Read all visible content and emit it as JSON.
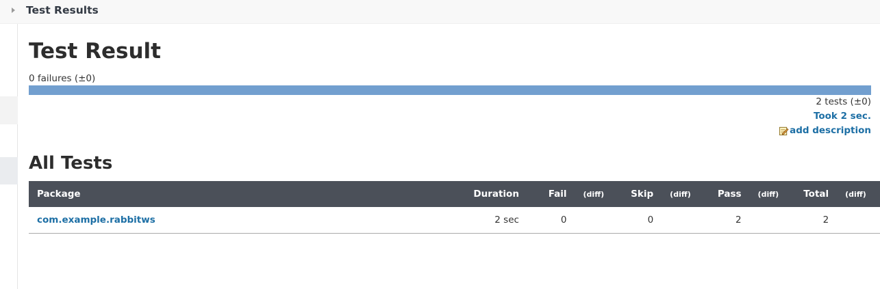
{
  "breadcrumb": {
    "label": "Test Results"
  },
  "page": {
    "title": "Test Result",
    "failures_summary": "0 failures (±0)",
    "pass_fraction": 1.0,
    "tests_count": "2 tests (±0)",
    "duration_link": "Took 2 sec.",
    "add_description": "add description",
    "bar_color": "#729fcf",
    "link_color": "#1d6fa5",
    "header_color": "#4b5059"
  },
  "all_tests": {
    "title": "All Tests",
    "columns": {
      "package": "Package",
      "duration": "Duration",
      "fail": "Fail",
      "fail_diff": "(diff)",
      "skip": "Skip",
      "skip_diff": "(diff)",
      "pass": "Pass",
      "pass_diff": "(diff)",
      "total": "Total",
      "total_diff": "(diff)"
    },
    "rows": [
      {
        "package": "com.example.rabbitws",
        "duration": "2 sec",
        "fail": "0",
        "fail_diff": "",
        "skip": "0",
        "skip_diff": "",
        "pass": "2",
        "pass_diff": "",
        "total": "2",
        "total_diff": ""
      }
    ]
  }
}
